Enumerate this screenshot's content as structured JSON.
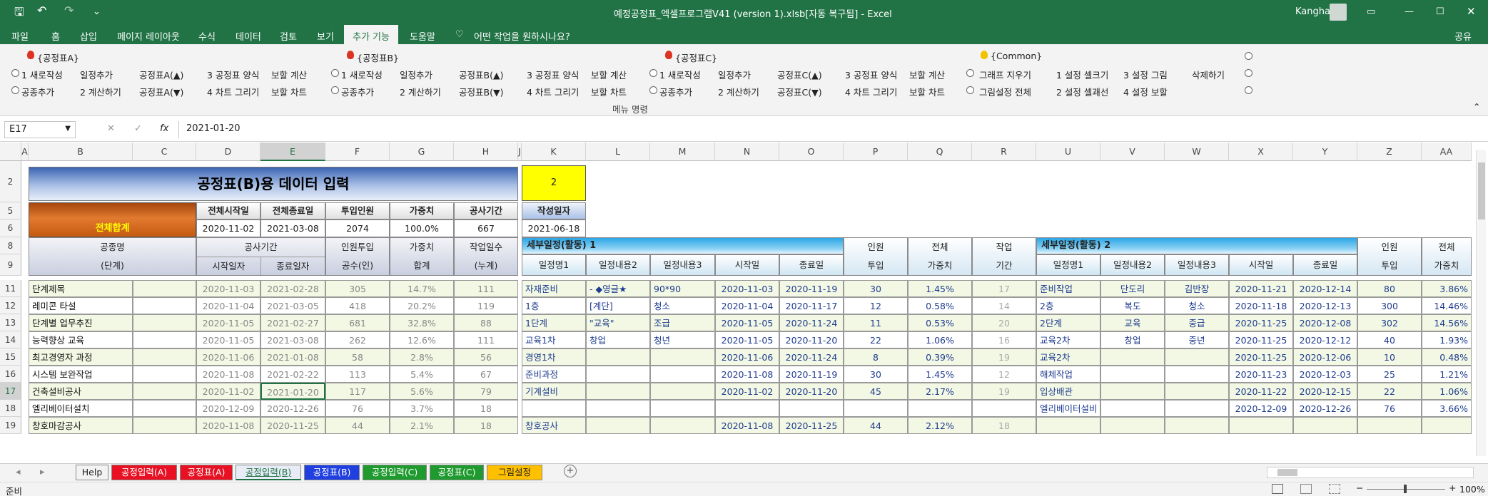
{
  "window": {
    "title": "예정공정표_엑셀프로그램V41 (version 1).xlsb[자동 복구됨] - Excel",
    "user": "Kangha"
  },
  "menu": [
    "파일",
    "홈",
    "삽입",
    "페이지 레이아웃",
    "수식",
    "데이터",
    "검토",
    "보기",
    "추가 기능",
    "도움말"
  ],
  "menu_search": "어떤 작업을 원하시나요?",
  "share": "공유",
  "ribbon": {
    "groupA": {
      "title": "{공정표A}",
      "r1": [
        "1 새로작성",
        "일정추가",
        "공정표A(▲)",
        "3 공정표 양식",
        "보할 계산"
      ],
      "r2": [
        "공종추가",
        "2 계산하기",
        "공정표A(▼)",
        "4 차트 그리기",
        "보할 차트"
      ]
    },
    "groupB": {
      "title": "{공정표B}",
      "r1": [
        "1 새로작성",
        "일정추가",
        "공정표B(▲)",
        "3 공정표 양식",
        "보할 계산"
      ],
      "r2": [
        "공종추가",
        "2 계산하기",
        "공정표B(▼)",
        "4 차트 그리기",
        "보할 차트"
      ]
    },
    "groupC": {
      "title": "{공정표C}",
      "r1": [
        "1 새로작성",
        "일정추가",
        "공정표C(▲)",
        "3 공정표 양식",
        "보할 계산"
      ],
      "r2": [
        "공종추가",
        "2 계산하기",
        "공정표C(▼)",
        "4 차트 그리기",
        "보할 차트"
      ]
    },
    "common": {
      "title": "{Common}",
      "r1": [
        "그래프 지우기",
        "1 설정 셀크기",
        "3 설정 그림",
        "삭제하기"
      ],
      "r2": [
        "그림설정 전체",
        "2 설정 셀괘선",
        "4 설정 보할"
      ]
    },
    "footer": "메뉴 명령"
  },
  "formula": {
    "cell": "E17",
    "fx": "fx",
    "value": "2021-01-20"
  },
  "columns": [
    "A",
    "B",
    "C",
    "D",
    "E",
    "F",
    "G",
    "H",
    "J",
    "K",
    "L",
    "M",
    "N",
    "O",
    "P",
    "Q",
    "R",
    "U",
    "V",
    "W",
    "X",
    "Y",
    "Z",
    "AA"
  ],
  "rows": [
    "2",
    "5",
    "6",
    "8",
    "9",
    "11",
    "12",
    "13",
    "14",
    "15",
    "16",
    "17",
    "18",
    "19"
  ],
  "sheet": {
    "title": "공정표(B)용 데이터 입력",
    "k2": "2",
    "summary_headers": [
      "전체시작일",
      "전체종료일",
      "투입인원",
      "가중치",
      "공사기간"
    ],
    "summary_label": "전체합계",
    "summary_values": [
      "2020-11-02",
      "2021-03-08",
      "2074",
      "100.0%",
      "667"
    ],
    "write_date_label": "작성일자",
    "write_date": "2021-06-18",
    "hdr": {
      "name1": "공종명",
      "name2": "(단계)",
      "period": "공사기간",
      "start": "시작일자",
      "end": "종료일자",
      "staff1": "인원투입",
      "staff2": "공수(인)",
      "weight1": "가중치",
      "weight2": "합계",
      "days1": "작업일수",
      "days2": "(누계)"
    },
    "act1": "세부일정(활동) 1",
    "act2": "세부일정(활동) 2",
    "sub": {
      "n1": "일정명1",
      "n2": "일정내용2",
      "n3": "일정내용3",
      "s": "시작일",
      "e": "종료일",
      "staff1": "인원",
      "staff2": "투입",
      "w1": "전체",
      "w2": "가중치",
      "d1": "작업",
      "d2": "기간"
    },
    "rows": [
      {
        "name": "단계제목",
        "s": "2020-11-03",
        "e": "2021-02-28",
        "p": "305",
        "w": "14.7%",
        "d": "111",
        "a1": [
          "자재준비",
          "- ◆영글★",
          "90*90",
          "2020-11-03",
          "2020-11-19",
          "30",
          "1.45%",
          "17"
        ],
        "a2": [
          "준비작업",
          "단도리",
          "김반장",
          "2020-11-21",
          "2020-12-14",
          "80",
          "3.86%"
        ]
      },
      {
        "name": "레미콘 타설",
        "s": "2020-11-04",
        "e": "2021-03-05",
        "p": "418",
        "w": "20.2%",
        "d": "119",
        "a1": [
          "1층",
          "[계단]",
          "청소",
          "2020-11-04",
          "2020-11-17",
          "12",
          "0.58%",
          "14"
        ],
        "a2": [
          "2층",
          "복도",
          "청소",
          "2020-11-18",
          "2020-12-13",
          "300",
          "14.46%"
        ]
      },
      {
        "name": "단계별 업무추진",
        "s": "2020-11-05",
        "e": "2021-02-27",
        "p": "681",
        "w": "32.8%",
        "d": "88",
        "a1": [
          "1단계",
          "\"교육\"",
          "조급",
          "2020-11-05",
          "2020-11-24",
          "11",
          "0.53%",
          "20"
        ],
        "a2": [
          "2단계",
          "교육",
          "중급",
          "2020-11-25",
          "2020-12-08",
          "302",
          "14.56%"
        ]
      },
      {
        "name": "능력향상 교육",
        "s": "2020-11-05",
        "e": "2021-03-08",
        "p": "262",
        "w": "12.6%",
        "d": "111",
        "a1": [
          "교육1차",
          "창업",
          "청년",
          "2020-11-05",
          "2020-11-20",
          "22",
          "1.06%",
          "16"
        ],
        "a2": [
          "교육2차",
          "창업",
          "중년",
          "2020-11-25",
          "2020-12-12",
          "40",
          "1.93%"
        ]
      },
      {
        "name": "최고경영자 과정",
        "s": "2020-11-06",
        "e": "2021-01-08",
        "p": "58",
        "w": "2.8%",
        "d": "56",
        "a1": [
          "경영1차",
          "",
          "",
          "2020-11-06",
          "2020-11-24",
          "8",
          "0.39%",
          "19"
        ],
        "a2": [
          "교육2차",
          "",
          "",
          "2020-11-25",
          "2020-12-06",
          "10",
          "0.48%"
        ]
      },
      {
        "name": "시스템 보완작업",
        "s": "2020-11-08",
        "e": "2021-02-22",
        "p": "113",
        "w": "5.4%",
        "d": "67",
        "a1": [
          "준비과정",
          "",
          "",
          "2020-11-08",
          "2020-11-19",
          "30",
          "1.45%",
          "12"
        ],
        "a2": [
          "해체작업",
          "",
          "",
          "2020-11-23",
          "2020-12-03",
          "25",
          "1.21%"
        ]
      },
      {
        "name": "건축설비공사",
        "s": "2020-11-02",
        "e": "2021-01-20",
        "p": "117",
        "w": "5.6%",
        "d": "79",
        "a1": [
          "기계설비",
          "",
          "",
          "2020-11-02",
          "2020-11-20",
          "45",
          "2.17%",
          "19"
        ],
        "a2": [
          "입상배관",
          "",
          "",
          "2020-11-22",
          "2020-12-15",
          "22",
          "1.06%"
        ]
      },
      {
        "name": "엘리베이터설치",
        "s": "2020-12-09",
        "e": "2020-12-26",
        "p": "76",
        "w": "3.7%",
        "d": "18",
        "a1": [
          "",
          "",
          "",
          "",
          "",
          "",
          "",
          ""
        ],
        "a2": [
          "엘리베이터설비",
          "",
          "",
          "2020-12-09",
          "2020-12-26",
          "76",
          "3.66%"
        ]
      },
      {
        "name": "창호마감공사",
        "s": "2020-11-08",
        "e": "2020-11-25",
        "p": "44",
        "w": "2.1%",
        "d": "18",
        "a1": [
          "창호공사",
          "",
          "",
          "2020-11-08",
          "2020-11-25",
          "44",
          "2.12%",
          "18"
        ],
        "a2": [
          "",
          "",
          "",
          "",
          "",
          "",
          ""
        ]
      }
    ]
  },
  "tabs": [
    {
      "label": "Help",
      "color": "#f3f3f3",
      "fg": "#222"
    },
    {
      "label": "공정입력(A)",
      "color": "#e81123",
      "fg": "#fff"
    },
    {
      "label": "공정표(A)",
      "color": "#e81123",
      "fg": "#fff"
    },
    {
      "label": "공정입력(B)",
      "color": "#e7ecf7",
      "fg": "#217346"
    },
    {
      "label": "공정표(B)",
      "color": "#1f3fe0",
      "fg": "#fff"
    },
    {
      "label": "공정입력(C)",
      "color": "#1e9a2e",
      "fg": "#fff"
    },
    {
      "label": "공정표(C)",
      "color": "#1e9a2e",
      "fg": "#fff"
    },
    {
      "label": "그림설정",
      "color": "#ffc000",
      "fg": "#222"
    }
  ],
  "status": {
    "ready": "준비",
    "zoom": "100%"
  }
}
